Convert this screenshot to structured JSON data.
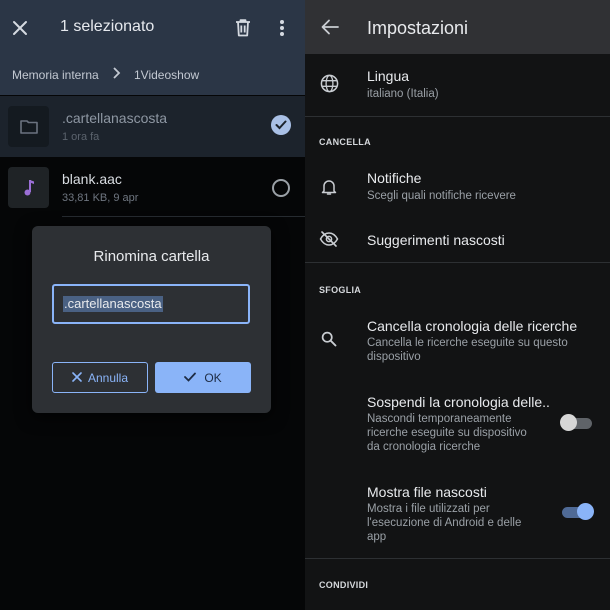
{
  "file_manager": {
    "selection_title": "1 selezionato",
    "breadcrumb": [
      "Memoria interna",
      "1Videoshow"
    ],
    "files": [
      {
        "name": ".cartellanascosta",
        "meta": "1 ora fa",
        "selected": true,
        "icon": "folder-icon"
      },
      {
        "name": "blank.aac",
        "meta": "33,81 KB, 9 apr",
        "selected": false,
        "icon": "music-note-icon"
      }
    ]
  },
  "rename_dialog": {
    "title": "Rinomina cartella",
    "input_value": ".cartellanascosta",
    "cancel_label": "Annulla",
    "ok_label": "OK"
  },
  "settings": {
    "title": "Impostazioni",
    "language": {
      "title": "Lingua",
      "subtitle": "italiano (Italia)"
    },
    "sections": {
      "cancella": "CANCELLA",
      "sfoglia": "SFOGLIA",
      "condividi": "CONDIVIDI"
    },
    "notifications": {
      "title": "Notifiche",
      "subtitle": "Scegli quali notifiche ricevere"
    },
    "hidden_suggestions": {
      "title": "Suggerimenti nascosti"
    },
    "clear_history": {
      "title": "Cancella cronologia delle ricerche",
      "subtitle_lines": [
        "Cancella le ricerche eseguite su questo",
        "dispositivo"
      ]
    },
    "pause_history": {
      "title": "Sospendi la cronologia delle..",
      "subtitle_lines": [
        "Nascondi temporaneamente",
        "ricerche eseguite su dispositivo",
        "da cronologia ricerche"
      ],
      "enabled": false
    },
    "show_hidden": {
      "title": "Mostra file nascosti",
      "subtitle_lines": [
        "Mostra i file utilizzati per",
        "l'esecuzione di Android e delle",
        "app"
      ],
      "enabled": true
    }
  },
  "colors": {
    "accent": "#8ab4f8",
    "left_header": "#2b3646",
    "dialog_bg": "#2d3034",
    "settings_bg": "#121314",
    "settings_appbar": "#303134"
  }
}
